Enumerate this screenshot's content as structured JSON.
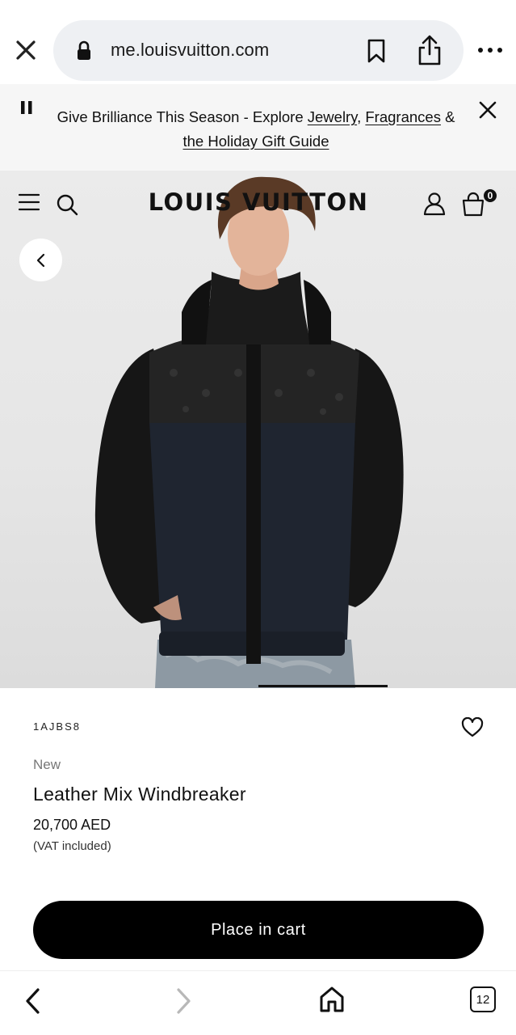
{
  "browser": {
    "url": "me.louisvuitton.com",
    "icons": [
      "close-icon",
      "lock-icon",
      "bookmark-icon",
      "share-icon",
      "more-icon"
    ]
  },
  "promo": {
    "text_before": "Give Brilliance This Season - Explore ",
    "link_jewelry": "Jewelry",
    "sep1": ", ",
    "link_fragrances": "Fragrances",
    "sep2": " & ",
    "link_gift_guide": "the Holiday Gift Guide"
  },
  "header": {
    "brand": "LOUIS VUITTON",
    "cart_count": "0"
  },
  "product": {
    "sku": "1AJBS8",
    "badge": "New",
    "title": "Leather Mix Windbreaker",
    "price": "20,700 AED",
    "vat_note": "(VAT included)",
    "cart_button": "Place in cart"
  },
  "bottom_nav": {
    "tab_count": "12"
  }
}
